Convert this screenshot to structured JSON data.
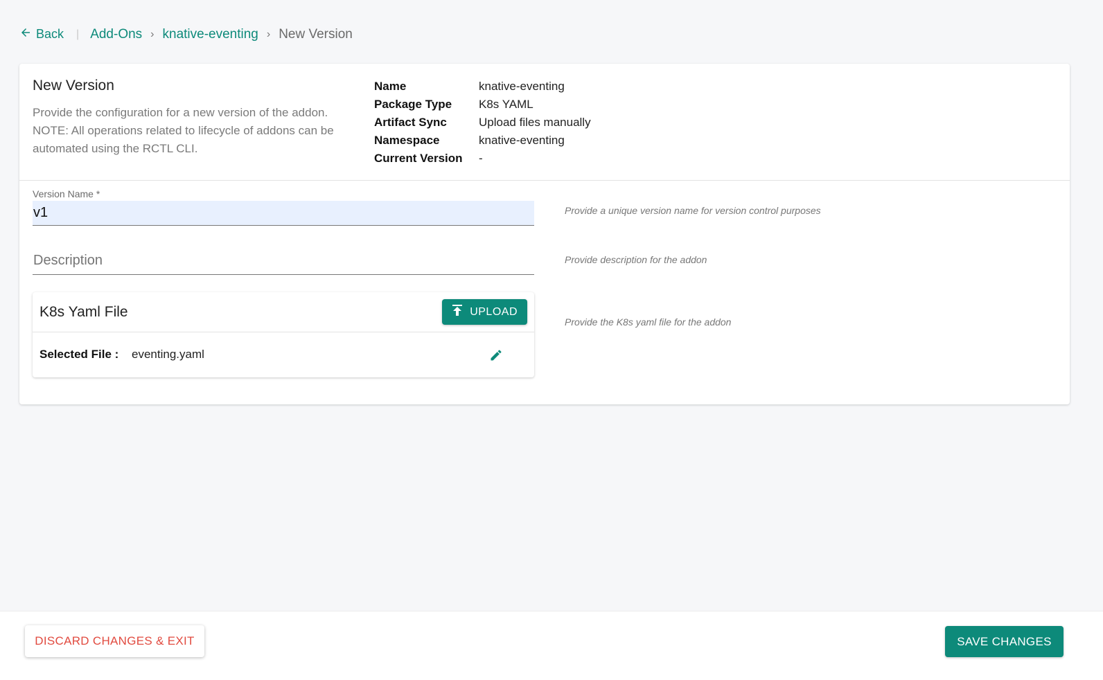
{
  "breadcrumb": {
    "back_label": "Back",
    "items": [
      "Add-Ons",
      "knative-eventing"
    ],
    "current": "New Version"
  },
  "header": {
    "title": "New Version",
    "description": "Provide the configuration for a new version of the addon. NOTE: All operations related to lifecycle of addons can be automated using the RCTL CLI.",
    "info": [
      {
        "label": "Name",
        "value": "knative-eventing"
      },
      {
        "label": "Package Type",
        "value": "K8s YAML"
      },
      {
        "label": "Artifact Sync",
        "value": "Upload files manually"
      },
      {
        "label": "Namespace",
        "value": "knative-eventing"
      },
      {
        "label": "Current Version",
        "value": "-"
      }
    ]
  },
  "form": {
    "version_name_label": "Version Name *",
    "version_name_value": "v1",
    "version_name_hint": "Provide a unique version name for version control purposes",
    "description_placeholder": "Description",
    "description_hint": "Provide description for the addon",
    "file_card_title": "K8s Yaml File",
    "upload_label": "UPLOAD",
    "file_hint": "Provide the K8s yaml file for the addon",
    "selected_file_label": "Selected File :",
    "selected_file_name": "eventing.yaml"
  },
  "footer": {
    "discard_label": "DISCARD CHANGES & EXIT",
    "save_label": "SAVE CHANGES"
  },
  "colors": {
    "accent": "#0d8a7a",
    "danger": "#e14a3f",
    "input_bg": "#e8f0fe"
  },
  "icons": {
    "back": "arrow-left-icon",
    "upload": "upload-icon",
    "edit": "pencil-icon"
  }
}
